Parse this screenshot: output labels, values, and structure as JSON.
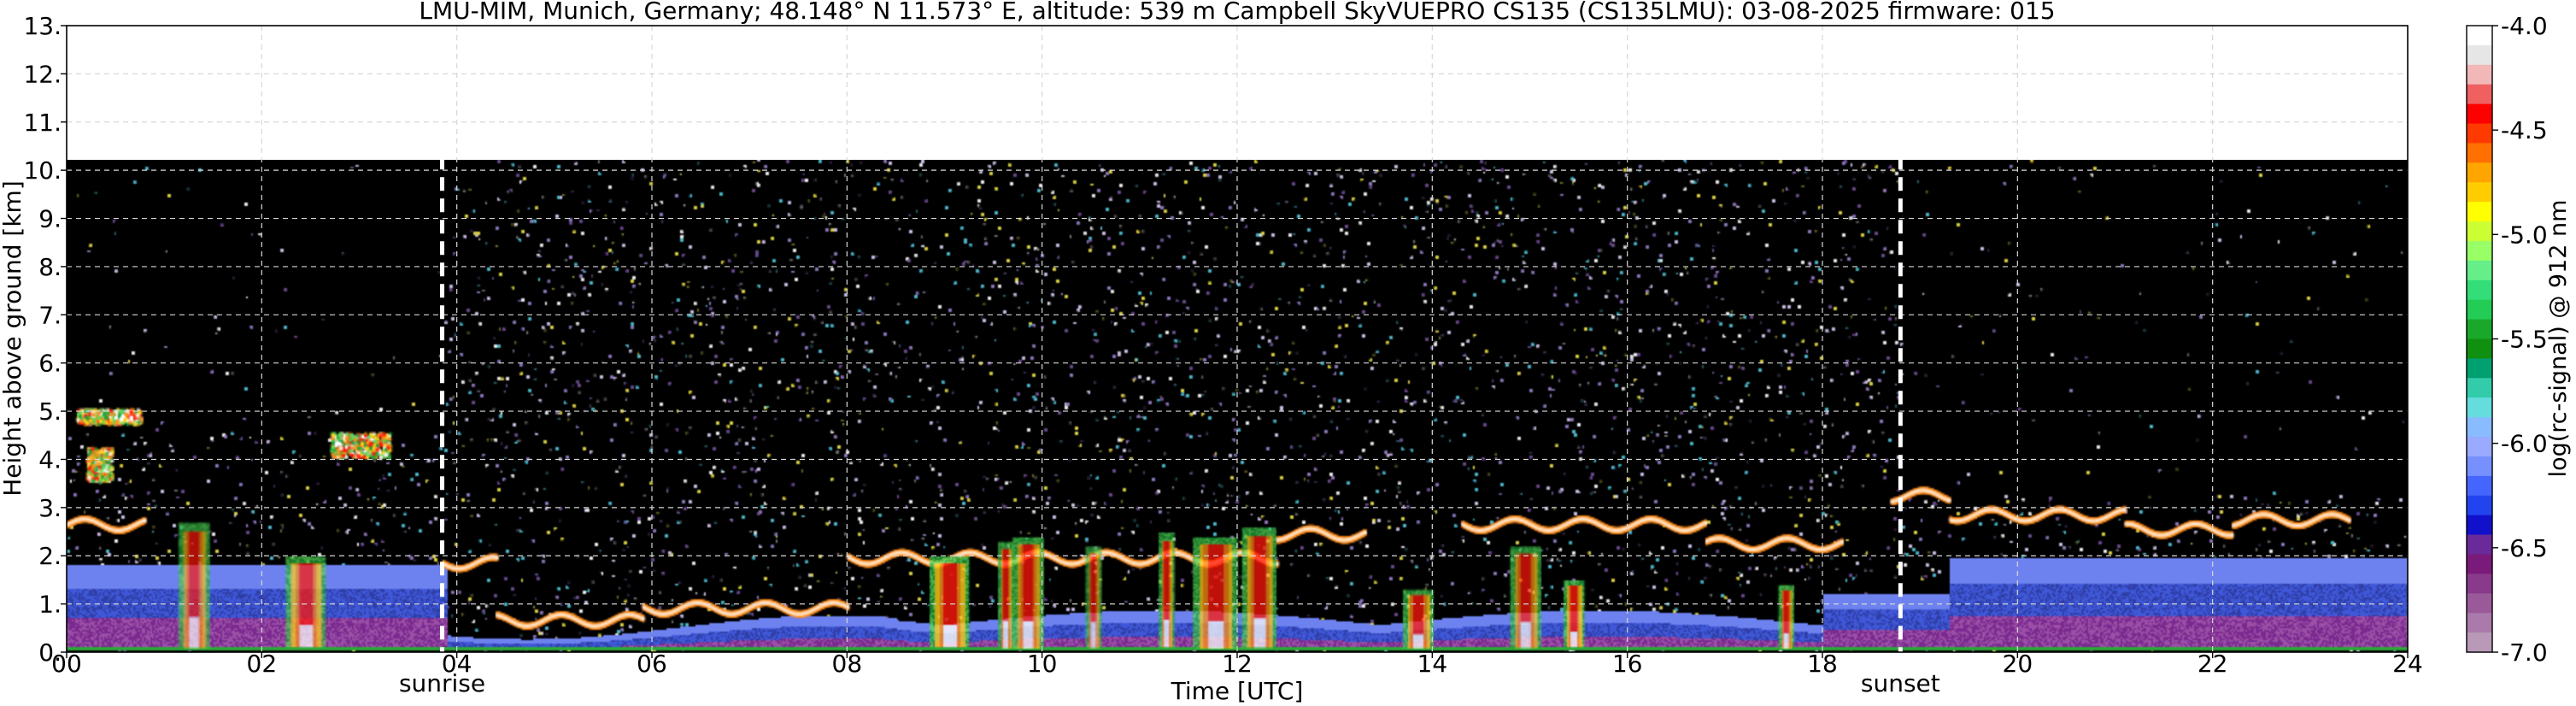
{
  "header": {
    "title": "LMU-MIM, Munich, Germany; 48.148° N 11.573° E, altitude: 539 m    Campbell SkyVUEPRO CS135 (CS135LMU): 03-08-2025    firmware: 015"
  },
  "colors": {
    "background": "#000000",
    "noise": [
      "#6a4e8c",
      "#8e78b8",
      "#c9bde0",
      "#52b5c9",
      "#d8ce4a",
      "#e9e9e9"
    ],
    "aerosol_layer": [
      "#2f3ea6",
      "#3f58d8",
      "#6d82ee",
      "#7a2a8f",
      "#9b4fa6"
    ],
    "cloud": [
      "#ffffff",
      "#ff1a0d",
      "#ff8c1a",
      "#ffd21a",
      "#5fd85a",
      "#1fa33a"
    ],
    "marker_line": "#ffffff"
  },
  "chart_data": {
    "type": "heatmap",
    "xlabel": "Time [UTC]",
    "ylabel": "Height above ground [km]",
    "xlim": [
      0,
      24
    ],
    "ylim": [
      0,
      13
    ],
    "x_ticks": [
      0,
      2,
      4,
      6,
      8,
      10,
      12,
      14,
      16,
      18,
      20,
      22,
      24
    ],
    "x_tick_labels": [
      "00",
      "02",
      "04",
      "06",
      "08",
      "10",
      "12",
      "14",
      "16",
      "18",
      "20",
      "22",
      "24"
    ],
    "y_ticks": [
      0,
      1,
      2,
      3,
      4,
      5,
      6,
      7,
      8,
      9,
      10,
      11,
      12,
      13
    ],
    "y_tick_labels": [
      "0.",
      "1.",
      "2.",
      "3.",
      "4.",
      "5.",
      "6.",
      "7.",
      "8.",
      "9.",
      "10.",
      "11.",
      "12.",
      "13."
    ],
    "grid": true,
    "data_top_km": 10.3,
    "annotations": [
      {
        "label": "sunrise",
        "x": 3.85
      },
      {
        "label": "sunset",
        "x": 18.8
      }
    ],
    "colorbar": {
      "label": "log(rc-signal) @ 912 nm",
      "range": [
        -7.0,
        -4.0
      ],
      "ticks": [
        -4.0,
        -4.5,
        -5.0,
        -5.5,
        -6.0,
        -6.5,
        -7.0
      ],
      "tick_labels": [
        "-4.0",
        "-4.5",
        "-5.0",
        "-5.5",
        "-6.0",
        "-6.5",
        "-7.0"
      ],
      "colors": [
        "#ffffff",
        "#e6e6e6",
        "#f2b8b8",
        "#f06060",
        "#ff0000",
        "#ff3a00",
        "#ff7000",
        "#ffa500",
        "#ffcc00",
        "#ffff00",
        "#ccff33",
        "#99ff66",
        "#66ee88",
        "#33dd77",
        "#22cc55",
        "#1aa82a",
        "#109010",
        "#00a070",
        "#33ccaa",
        "#66dddd",
        "#88bbff",
        "#99aaff",
        "#7790ff",
        "#4466ff",
        "#2244ee",
        "#1111cc",
        "#6a2a9a",
        "#7a1a7a",
        "#8a3a8a",
        "#9a5a9a",
        "#aa7aaa",
        "#b89ab8"
      ]
    },
    "cloud_events": [
      {
        "t0": 1.15,
        "t1": 1.45,
        "top": 2.7
      },
      {
        "t0": 2.25,
        "t1": 2.65,
        "top": 2.0
      },
      {
        "t0": 8.85,
        "t1": 9.25,
        "top": 2.0
      },
      {
        "t0": 9.55,
        "t1": 9.7,
        "top": 2.3
      },
      {
        "t0": 9.7,
        "t1": 10.0,
        "top": 2.4
      },
      {
        "t0": 10.45,
        "t1": 10.6,
        "top": 2.2
      },
      {
        "t0": 11.2,
        "t1": 11.35,
        "top": 2.5
      },
      {
        "t0": 11.55,
        "t1": 12.0,
        "top": 2.4
      },
      {
        "t0": 12.05,
        "t1": 12.4,
        "top": 2.6
      },
      {
        "t0": 13.7,
        "t1": 14.0,
        "top": 1.3
      },
      {
        "t0": 14.8,
        "t1": 15.1,
        "top": 2.2
      },
      {
        "t0": 15.35,
        "t1": 15.55,
        "top": 1.5
      },
      {
        "t0": 17.55,
        "t1": 17.7,
        "top": 1.4
      }
    ],
    "layer_segments": [
      {
        "t0": 0.0,
        "t1": 0.8,
        "h": 2.7
      },
      {
        "t0": 3.85,
        "t1": 4.4,
        "h": 1.9
      },
      {
        "t0": 4.4,
        "t1": 5.9,
        "h": 0.7
      },
      {
        "t0": 5.9,
        "t1": 8.0,
        "h": 0.95
      },
      {
        "t0": 8.0,
        "t1": 12.4,
        "h": 2.0
      },
      {
        "t0": 12.4,
        "t1": 13.3,
        "h": 2.5
      },
      {
        "t0": 14.3,
        "t1": 16.8,
        "h": 2.7
      },
      {
        "t0": 16.8,
        "t1": 18.2,
        "h": 2.3
      },
      {
        "t0": 18.7,
        "t1": 19.3,
        "h": 3.3
      },
      {
        "t0": 19.3,
        "t1": 21.1,
        "h": 2.9
      },
      {
        "t0": 21.1,
        "t1": 22.2,
        "h": 2.6
      },
      {
        "t0": 22.2,
        "t1": 23.4,
        "h": 2.8
      }
    ],
    "elevated_layers": [
      {
        "t0": 0.1,
        "t1": 0.75,
        "y0": 4.8,
        "y1": 5.1
      },
      {
        "t0": 0.2,
        "t1": 0.45,
        "y0": 3.6,
        "y1": 4.3
      },
      {
        "t0": 2.7,
        "t1": 3.3,
        "y0": 4.1,
        "y1": 4.6
      }
    ]
  }
}
